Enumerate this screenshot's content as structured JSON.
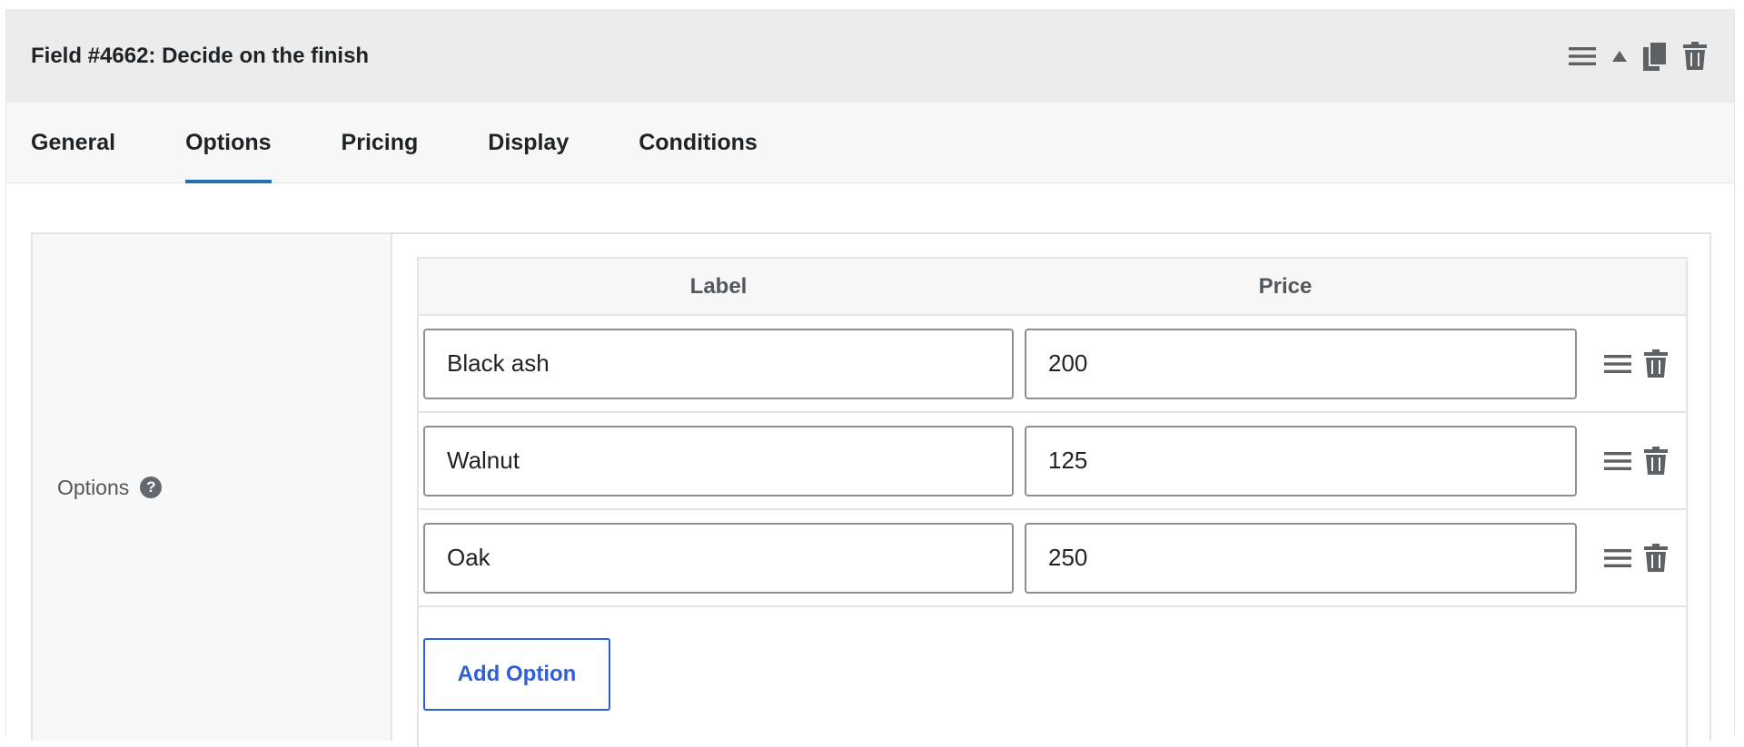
{
  "header": {
    "title": "Field #4662: Decide on the finish",
    "icons": [
      "menu-icon",
      "collapse-arrow-icon",
      "duplicate-icon",
      "trash-icon"
    ]
  },
  "tabs": [
    {
      "label": "General",
      "active": false
    },
    {
      "label": "Options",
      "active": true
    },
    {
      "label": "Pricing",
      "active": false
    },
    {
      "label": "Display",
      "active": false
    },
    {
      "label": "Conditions",
      "active": false
    }
  ],
  "settings": {
    "label": "Options",
    "help": "?"
  },
  "table": {
    "columns": [
      "Label",
      "Price"
    ],
    "rows": [
      {
        "label": "Black ash",
        "price": "200"
      },
      {
        "label": "Walnut",
        "price": "125"
      },
      {
        "label": "Oak",
        "price": "250"
      }
    ]
  },
  "add_button": "Add Option",
  "colors": {
    "accent": "#2271b1",
    "button": "#2c5fd8",
    "header_bg": "#ececec",
    "icon": "#5c6166"
  }
}
